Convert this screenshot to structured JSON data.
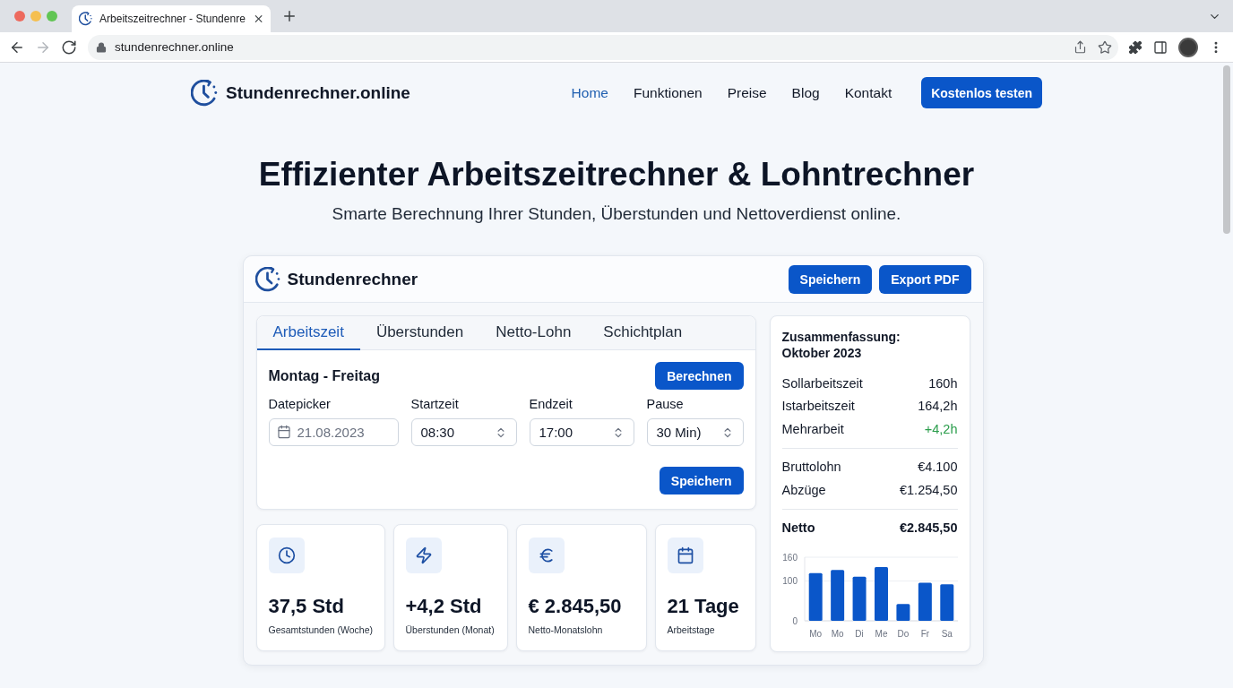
{
  "browser": {
    "tab": {
      "title": "Arbeitszeitrechner - Stundenre"
    },
    "nav_buttons": [
      {
        "kind": "back",
        "disabled": false
      },
      {
        "kind": "forward",
        "disabled": true
      },
      {
        "kind": "reload",
        "disabled": false
      }
    ],
    "url": "stundenrechner.online"
  },
  "site_header": {
    "brand": "Stundenrechner.online",
    "nav": [
      {
        "label": "Home",
        "selected": true
      },
      {
        "label": "Funktionen",
        "selected": false
      },
      {
        "label": "Preise",
        "selected": false
      },
      {
        "label": "Blog",
        "selected": false
      },
      {
        "label": "Kontakt",
        "selected": false
      }
    ],
    "cta": "Kostenlos testen"
  },
  "hero": {
    "title": "Effizienter Arbeitszeitrechner & Lohntrechner",
    "subtitle": "Smarte Berechnung Ihrer Stunden, Überstunden und Nettoverdienst online."
  },
  "calculator": {
    "title": "Stundenrechner",
    "actions": [
      "Speichern",
      "Export PDF"
    ],
    "tabs": [
      {
        "label": "Arbeitszeit",
        "selected": true
      },
      {
        "label": "Überstunden",
        "selected": false
      },
      {
        "label": "Netto-Lohn",
        "selected": false
      },
      {
        "label": "Schichtplan",
        "selected": false
      }
    ],
    "form": {
      "heading": "Montag - Freitag",
      "calculate": "Berechnen",
      "fields": [
        {
          "kind": "date",
          "label": "Datepicker",
          "placeholder": "21.08.2023"
        },
        {
          "kind": "select",
          "label": "Startzeit",
          "value": "08:30"
        },
        {
          "kind": "select",
          "label": "Endzeit",
          "value": "17:00"
        },
        {
          "kind": "select",
          "label": "Pause",
          "value": "30 Min)"
        }
      ],
      "save": "Speichern"
    },
    "stats": [
      {
        "value": "37,5 Std",
        "label": "Gesamtstunden (Woche)"
      },
      {
        "value": "+4,2 Std",
        "label": "Überstunden (Monat)"
      },
      {
        "value": "€ 2.845,50",
        "label": "Netto-Monatslohn"
      },
      {
        "value": "21 Tage",
        "label": "Arbeitstage"
      }
    ],
    "summary": {
      "title": "Zusammenfassung: Oktober 2023",
      "groups": [
        [
          {
            "label": "Sollarbeitszeit",
            "value": "160h",
            "positive": false
          },
          {
            "label": "Istarbeitszeit",
            "value": "164,2h",
            "positive": false
          },
          {
            "label": "Mehrarbeit",
            "value": "+4,2h",
            "positive": true
          }
        ],
        [
          {
            "label": "Bruttolohn",
            "value": "€4.100",
            "positive": false
          },
          {
            "label": "Abzüge",
            "value": "€1.254,50",
            "positive": false
          }
        ]
      ],
      "total": {
        "label": "Netto",
        "value": "€2.845,50"
      },
      "chart_data": {
        "type": "bar",
        "categories": [
          "Mo",
          "Mo",
          "Di",
          "Me",
          "Do",
          "Fr",
          "Sa"
        ],
        "values": [
          120,
          128,
          111,
          135,
          42,
          96,
          92
        ],
        "color": "#0a56c9",
        "ylim": [
          0,
          160
        ],
        "yticks": [
          0,
          100,
          160
        ],
        "grid": true
      }
    }
  }
}
